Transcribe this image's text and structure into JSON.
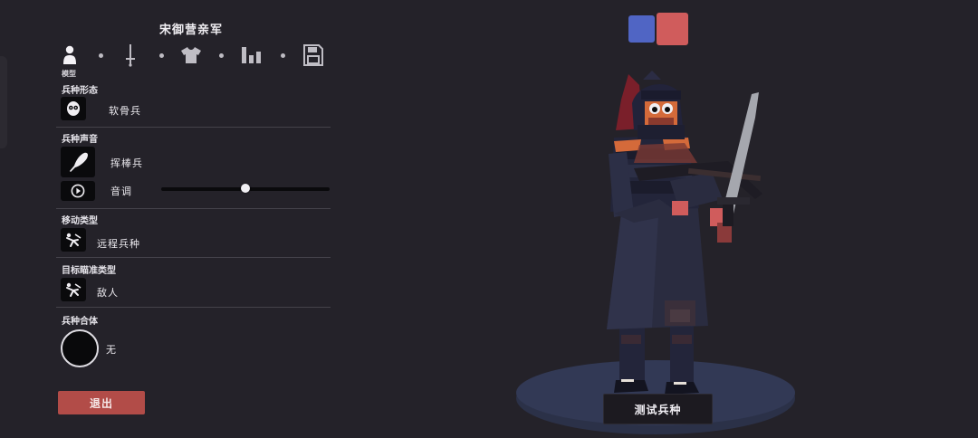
{
  "unit_name": "宋御营亲军",
  "tabs": [
    {
      "icon": "person-icon",
      "caption": "模型",
      "active": true
    },
    {
      "icon": "sword-icon",
      "caption": ""
    },
    {
      "icon": "shirt-icon",
      "caption": ""
    },
    {
      "icon": "stats-icon",
      "caption": ""
    },
    {
      "icon": "save-icon",
      "caption": ""
    }
  ],
  "sections": {
    "form": {
      "label": "兵种形态",
      "value": "软骨兵",
      "icon": "mask-face-icon"
    },
    "voice": {
      "label": "兵种声音",
      "value": "挥棒兵",
      "icon": "club-icon",
      "pitch_label": "音调",
      "pitch_level": 0.5,
      "play_icon": "play-icon"
    },
    "movement": {
      "label": "移动类型",
      "value": "远程兵种",
      "icon": "ranged-unit-icon"
    },
    "targeting": {
      "label": "目标瞄准类型",
      "value": "敌人",
      "icon": "target-enemy-icon"
    },
    "combine": {
      "label": "兵种合体",
      "value": "无"
    }
  },
  "exit_label": "退出",
  "test_label": "测试兵种",
  "teams": [
    {
      "name": "blue-team",
      "color": "#5065c4",
      "selected": false
    },
    {
      "name": "red-team",
      "color": "#d05c5c",
      "selected": true
    }
  ],
  "colors": {
    "background": "#242229",
    "accent_red": "#b24c48",
    "unit_armor": "#2a2c40",
    "unit_trim": "#d46a3a"
  }
}
